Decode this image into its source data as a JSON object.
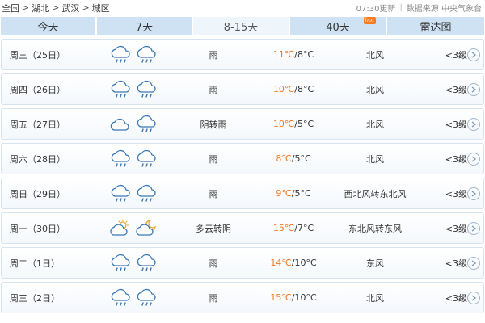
{
  "breadcrumb": [
    "全国",
    "湖北",
    "武汉",
    "城区"
  ],
  "update_time": "07:30更新",
  "source": "数据来源 中央气象台",
  "tabs": [
    {
      "label": "今天",
      "active": false,
      "badge": ""
    },
    {
      "label": "7天",
      "active": false,
      "badge": ""
    },
    {
      "label": "8-15天",
      "active": true,
      "badge": ""
    },
    {
      "label": "40天",
      "active": false,
      "badge": "hot"
    },
    {
      "label": "雷达图",
      "active": false,
      "badge": ""
    }
  ],
  "colors": {
    "accent_temp": "#f07a22",
    "tab_bg": "#cfe2f3",
    "tab_active_bg": "#eef5fb",
    "badge": "#ff7a1a"
  },
  "forecast": [
    {
      "day": "周三（25日）",
      "icons": [
        "rain-icon",
        "rain-icon"
      ],
      "desc": "雨",
      "high": "11℃",
      "low": "/8°C",
      "wind": "北风",
      "level": "<3级"
    },
    {
      "day": "周四（26日）",
      "icons": [
        "rain-icon",
        "rain-icon"
      ],
      "desc": "雨",
      "high": "10℃",
      "low": "/8°C",
      "wind": "北风",
      "level": "<3级"
    },
    {
      "day": "周五（27日）",
      "icons": [
        "overcast-icon",
        "rain-icon"
      ],
      "desc": "阴转雨",
      "high": "10℃",
      "low": "/5°C",
      "wind": "北风",
      "level": "<3级"
    },
    {
      "day": "周六（28日）",
      "icons": [
        "rain-icon",
        "rain-icon"
      ],
      "desc": "雨",
      "high": "8℃",
      "low": "/5°C",
      "wind": "北风",
      "level": "<3级"
    },
    {
      "day": "周日（29日）",
      "icons": [
        "rain-icon",
        "rain-icon"
      ],
      "desc": "雨",
      "high": "9℃",
      "low": "/5°C",
      "wind": "西北风转东北风",
      "level": "<3级"
    },
    {
      "day": "周一（30日）",
      "icons": [
        "partly-cloudy-day-icon",
        "partly-cloudy-night-icon"
      ],
      "desc": "多云转阴",
      "high": "15℃",
      "low": "/7°C",
      "wind": "东北风转东风",
      "level": "<3级"
    },
    {
      "day": "周二（1日）",
      "icons": [
        "rain-icon",
        "rain-icon"
      ],
      "desc": "雨",
      "high": "14℃",
      "low": "/10°C",
      "wind": "东风",
      "level": "<3级"
    },
    {
      "day": "周三（2日）",
      "icons": [
        "rain-icon",
        "rain-icon"
      ],
      "desc": "雨",
      "high": "15℃",
      "low": "/10°C",
      "wind": "北风",
      "level": "<3级"
    }
  ]
}
